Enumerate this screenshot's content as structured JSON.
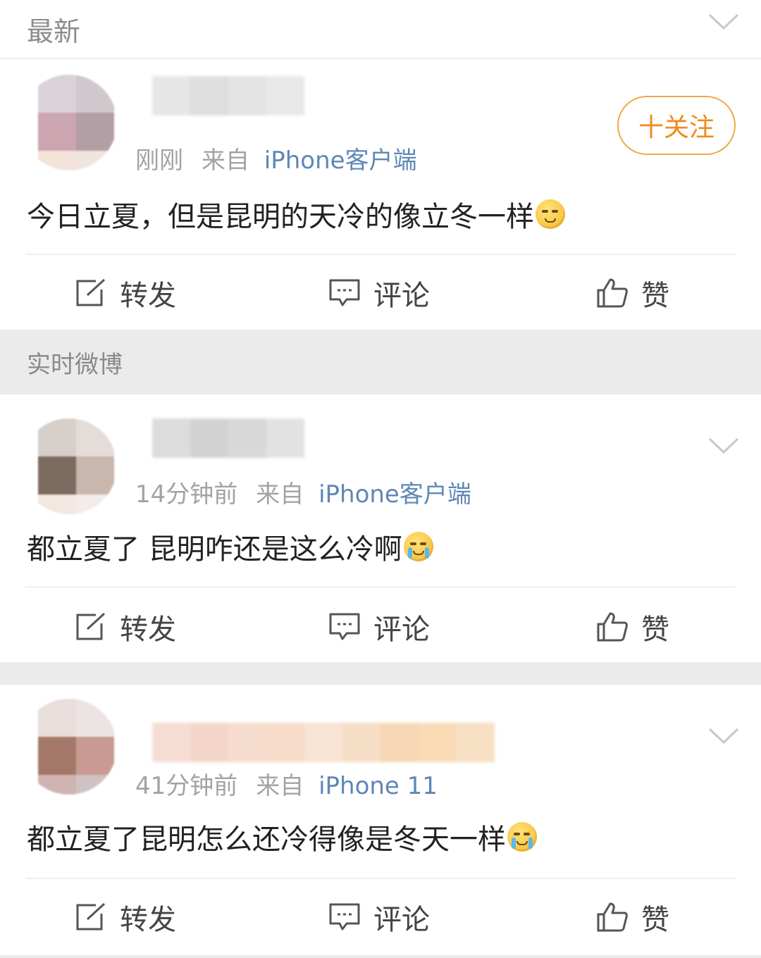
{
  "sections": {
    "latest_label": "最新",
    "live_label": "实时微博"
  },
  "posts": [
    {
      "time": "刚刚",
      "source_prefix": "来自",
      "source": "iPhone客户端",
      "follow_label": "十关注",
      "content": "今日立夏，但是昆明的天冷的像立冬一样",
      "emoji": "sweat-emoji-icon"
    },
    {
      "time": "14分钟前",
      "source_prefix": "来自",
      "source": "iPhone客户端",
      "content": "都立夏了 昆明咋还是这么冷啊",
      "emoji": "crying-emoji-icon"
    },
    {
      "time": "41分钟前",
      "source_prefix": "来自",
      "source": "iPhone 11",
      "content": "都立夏了昆明怎么还冷得像是冬天一样",
      "emoji": "crying-emoji-icon"
    }
  ],
  "actions": {
    "repost": "转发",
    "comment": "评论",
    "like": "赞"
  },
  "colors": {
    "accent_orange": "#f08a1c",
    "source_blue": "#5f87b6",
    "meta_gray": "#a3a3a3"
  }
}
